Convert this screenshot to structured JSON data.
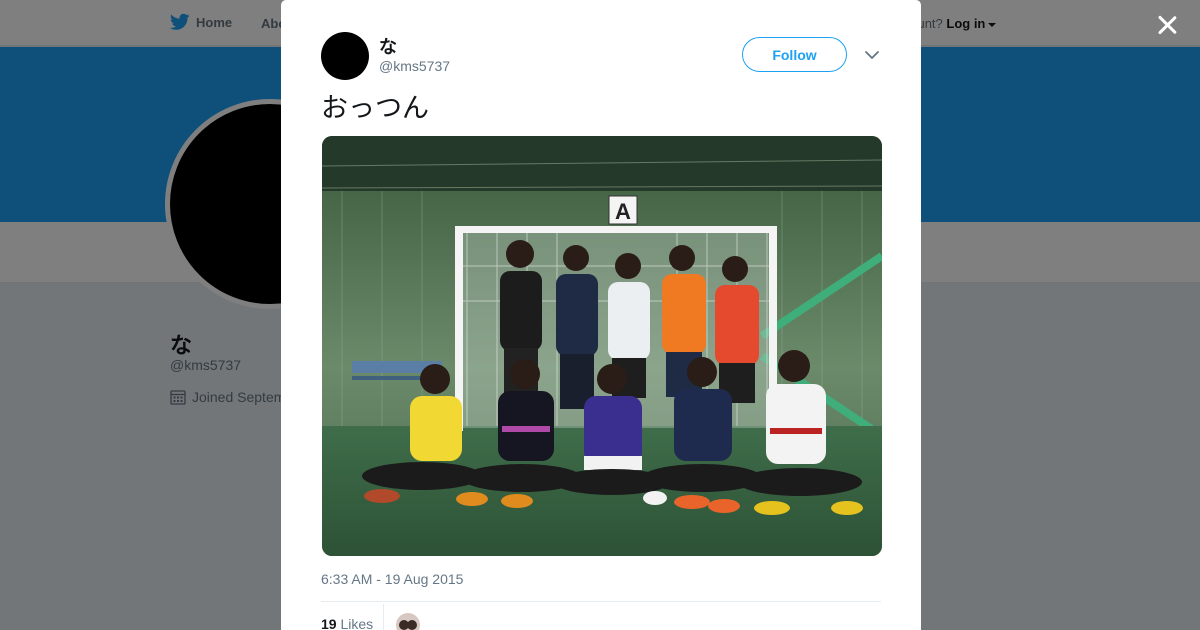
{
  "nav": {
    "home_label": "Home",
    "about_label": "Abo",
    "account_prompt": "account?",
    "login_label": "Log in"
  },
  "profile": {
    "name": "な",
    "handle": "@kms5737",
    "joined": "Joined Septem"
  },
  "tweet": {
    "author_name": "な",
    "author_handle": "@kms5737",
    "follow_label": "Follow",
    "text": "おっつん",
    "timestamp": "6:33 AM - 19 Aug 2015",
    "likes_count": "19",
    "likes_label": "Likes",
    "photo_goal_sign": "A"
  },
  "colors": {
    "brand": "#1da1f2",
    "banner": "#1da1f2",
    "text_primary": "#14171a",
    "text_secondary": "#657786"
  },
  "icons": {
    "nav_home": "twitter-bird-icon",
    "close": "close-icon",
    "caret": "caret-down-icon",
    "calendar": "calendar-icon",
    "menu": "chevron-down-icon"
  }
}
